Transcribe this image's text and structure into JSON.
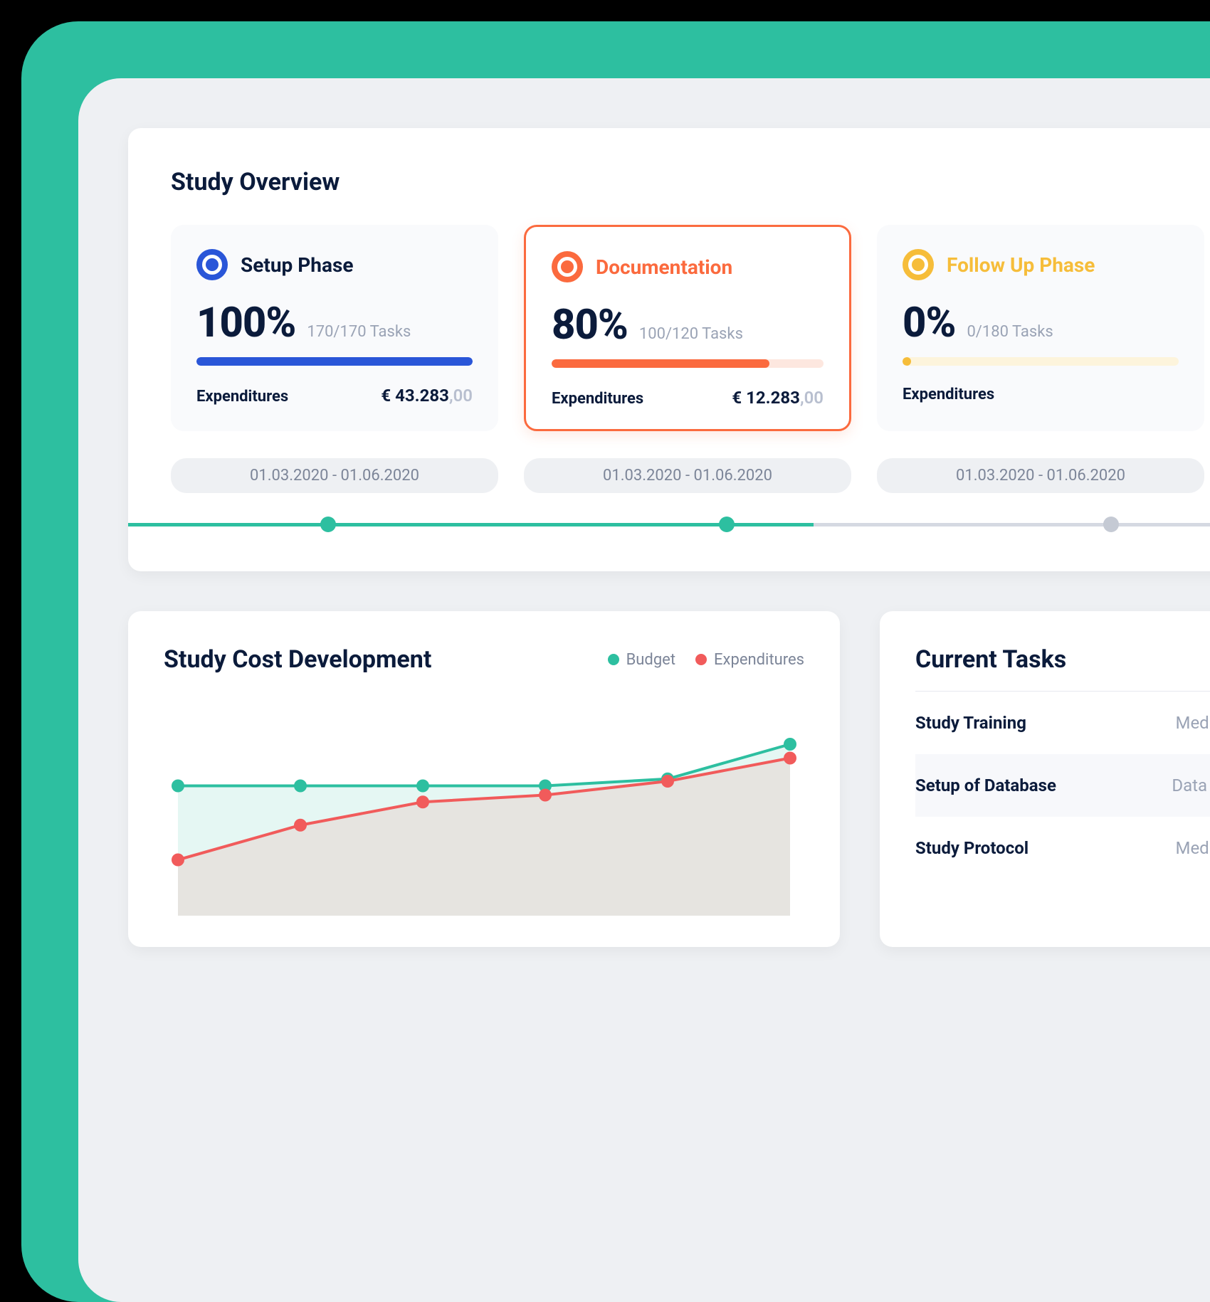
{
  "overview": {
    "title": "Study Overview",
    "phases": [
      {
        "name": "Setup Phase",
        "color": "blue",
        "active": false,
        "percent": "100%",
        "tasks": "170/170 Tasks",
        "progress": 100,
        "exp_label": "Expenditures",
        "exp_main": "€ 43.283",
        "exp_cents": ",00",
        "date_range": "01.03.2020 - 01.06.2020"
      },
      {
        "name": "Documentation",
        "color": "orange",
        "active": true,
        "percent": "80%",
        "tasks": "100/120 Tasks",
        "progress": 80,
        "exp_label": "Expenditures",
        "exp_main": "€ 12.283",
        "exp_cents": ",00",
        "date_range": "01.03.2020 - 01.06.2020"
      },
      {
        "name": "Follow Up Phase",
        "color": "yellow",
        "active": false,
        "percent": "0%",
        "tasks": "0/180 Tasks",
        "progress": 3,
        "exp_label": "Expenditures",
        "exp_main": "",
        "exp_cents": "",
        "date_range": "01.03.2020 - 01.06.2020"
      }
    ],
    "timeline_progress_pct": 58
  },
  "cost": {
    "title": "Study Cost Development",
    "legend": {
      "budget": "Budget",
      "expenditures": "Expenditures"
    }
  },
  "chart_data": {
    "type": "line",
    "x": [
      1,
      2,
      3,
      4,
      5,
      6
    ],
    "series": [
      {
        "name": "Budget",
        "color": "#2dbfa0",
        "values": [
          50,
          50,
          50,
          50,
          53,
          68
        ]
      },
      {
        "name": "Expenditures",
        "color": "#f15b5b",
        "values": [
          18,
          33,
          43,
          46,
          52,
          62
        ]
      }
    ],
    "ylim": [
      0,
      80
    ]
  },
  "tasks": {
    "title": "Current Tasks",
    "rows": [
      {
        "name": "Study Training",
        "category": "Medical"
      },
      {
        "name": "Setup of Database",
        "category": "Data Ma"
      },
      {
        "name": "Study Protocol",
        "category": "Medical"
      }
    ]
  }
}
